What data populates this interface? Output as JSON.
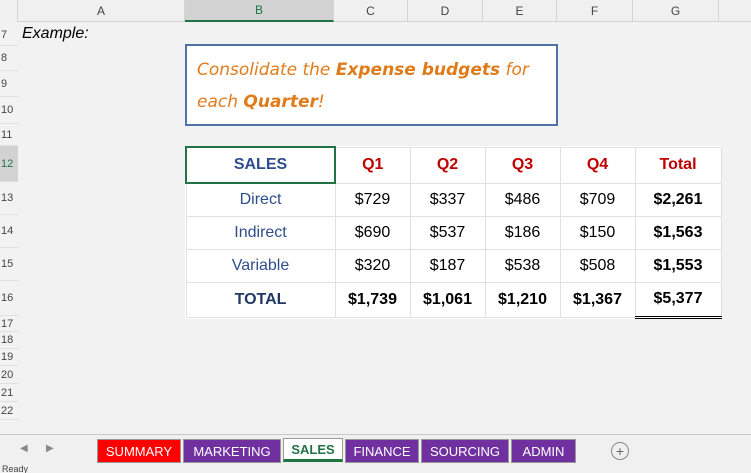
{
  "columns": [
    "A",
    "B",
    "C",
    "D",
    "E",
    "F",
    "G"
  ],
  "selected_column": "B",
  "rows": [
    "7",
    "8",
    "9",
    "10",
    "11",
    "12",
    "13",
    "14",
    "15",
    "16",
    "17",
    "18",
    "19",
    "20",
    "21",
    "22"
  ],
  "selected_row": "12",
  "example_label": "Example:",
  "note": {
    "line1_a": "Consolidate the ",
    "line1_b": "Expense budgets",
    "line1_c": " for",
    "line2_a": "each ",
    "line2_b": "Quarter",
    "line2_c": "!"
  },
  "table": {
    "header": {
      "label": "SALES",
      "q1": "Q1",
      "q2": "Q2",
      "q3": "Q3",
      "q4": "Q4",
      "total": "Total"
    },
    "rows": [
      {
        "label": "Direct",
        "q1": "$729",
        "q2": "$337",
        "q3": "$486",
        "q4": "$709",
        "total": "$2,261"
      },
      {
        "label": "Indirect",
        "q1": "$690",
        "q2": "$537",
        "q3": "$186",
        "q4": "$150",
        "total": "$1,563"
      },
      {
        "label": "Variable",
        "q1": "$320",
        "q2": "$187",
        "q3": "$538",
        "q4": "$508",
        "total": "$1,553"
      }
    ],
    "total_row": {
      "label": "TOTAL",
      "q1": "$1,739",
      "q2": "$1,061",
      "q3": "$1,210",
      "q4": "$1,367",
      "total": "$5,377"
    }
  },
  "sheet_tabs": [
    {
      "label": "SUMMARY",
      "color": "#ff0000"
    },
    {
      "label": "MARKETING",
      "color": "#7030a0"
    },
    {
      "label": "SALES",
      "color": "#ffffff",
      "active": true
    },
    {
      "label": "FINANCE",
      "color": "#7030a0"
    },
    {
      "label": "SOURCING",
      "color": "#7030a0"
    },
    {
      "label": "ADMIN",
      "color": "#7030a0"
    }
  ],
  "add_sheet_icon": "plus-circle-icon",
  "status_text": "Ready"
}
